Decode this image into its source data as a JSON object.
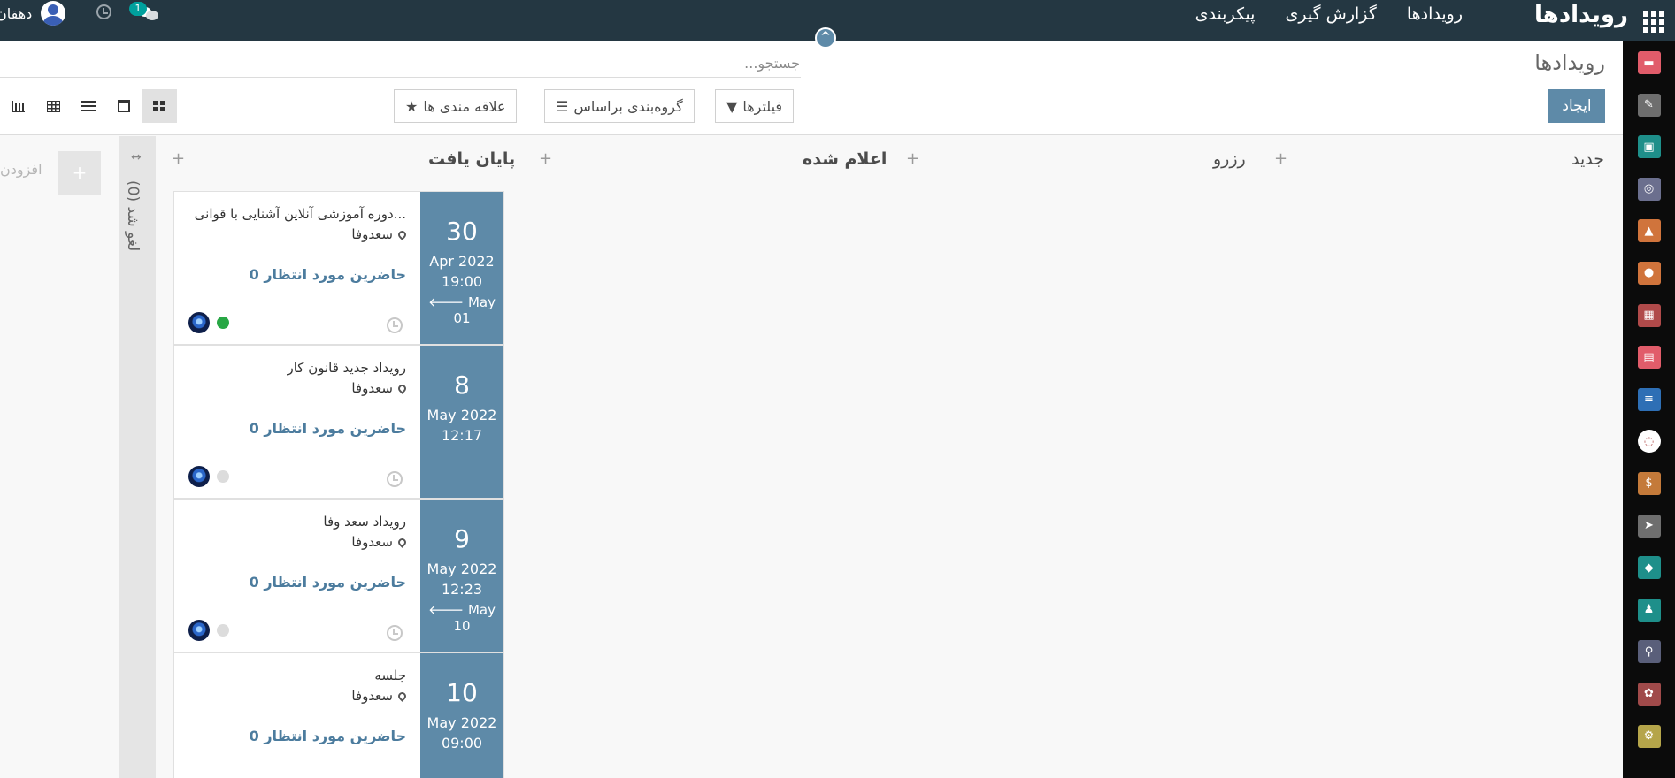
{
  "navbar": {
    "brand": "رویدادها",
    "menu": [
      "رویدادها",
      "گزارش گیری",
      "پیکربندی"
    ],
    "user_name": "دهقان",
    "chat_badge": "1"
  },
  "control_panel": {
    "title": "رویدادها",
    "search_placeholder": "جستجو...",
    "create_label": "ایجاد",
    "filters_label": "فیلترها",
    "groupby_label": "گروه‌بندی براساس",
    "favorites_label": "علاقه مندی ها"
  },
  "kanban": {
    "columns": [
      "جدید",
      "رزرو",
      "اعلام شده",
      "پایان یافت"
    ],
    "folded_label": "لغو شد (0)",
    "add_column": "افزودن"
  },
  "cards": [
    {
      "day": "30",
      "month": "Apr 2022",
      "time": "19:00",
      "end": "May 01",
      "title": "دوره آموزشی آنلاین آشنایی با قوانی...",
      "location": "سعدوفا",
      "attendees": "0 حاضرین مورد انتظار",
      "status": "green"
    },
    {
      "day": "8",
      "month": "May 2022",
      "time": "12:17",
      "end": "",
      "title": "رویداد جدید قانون کار",
      "location": "سعدوفا",
      "attendees": "0 حاضرین مورد انتظار",
      "status": "grey"
    },
    {
      "day": "9",
      "month": "May 2022",
      "time": "12:23",
      "end": "May 10",
      "title": "رویداد سعد وفا",
      "location": "سعدوفا",
      "attendees": "0 حاضرین مورد انتظار",
      "status": "grey"
    },
    {
      "day": "10",
      "month": "May 2022",
      "time": "09:00",
      "end": "",
      "title": "جلسه",
      "location": "سعدوفا",
      "attendees": "0 حاضرین مورد انتظار",
      "status": "green"
    }
  ],
  "side_apps": [
    {
      "icon": "discuss-icon",
      "color": "#e15c6a"
    },
    {
      "icon": "notes-icon",
      "color": "#6e6e6e"
    },
    {
      "icon": "contacts-icon",
      "color": "#1e8f8a"
    },
    {
      "icon": "crm-icon",
      "color": "#6b6f8e"
    },
    {
      "icon": "sales-icon",
      "color": "#d0743c"
    },
    {
      "icon": "website-icon",
      "color": "#d0743c"
    },
    {
      "icon": "helpdesk-icon",
      "color": "#b04a4a"
    },
    {
      "icon": "dashboard-icon",
      "color": "#e15c6a"
    },
    {
      "icon": "forms-icon",
      "color": "#2e6fb5"
    },
    {
      "icon": "timesheet-icon",
      "color": "#ffffff"
    },
    {
      "icon": "invoicing-icon",
      "color": "#c47a3a"
    },
    {
      "icon": "email-marketing-icon",
      "color": "#6e6e6e"
    },
    {
      "icon": "events-icon",
      "color": "#1e8f8a"
    },
    {
      "icon": "employees-icon",
      "color": "#1e8f8a"
    },
    {
      "icon": "recruitment-icon",
      "color": "#5a5f7a"
    },
    {
      "icon": "apps-icon",
      "color": "#a04a4a"
    },
    {
      "icon": "settings-icon",
      "color": "#b5a54a"
    }
  ]
}
